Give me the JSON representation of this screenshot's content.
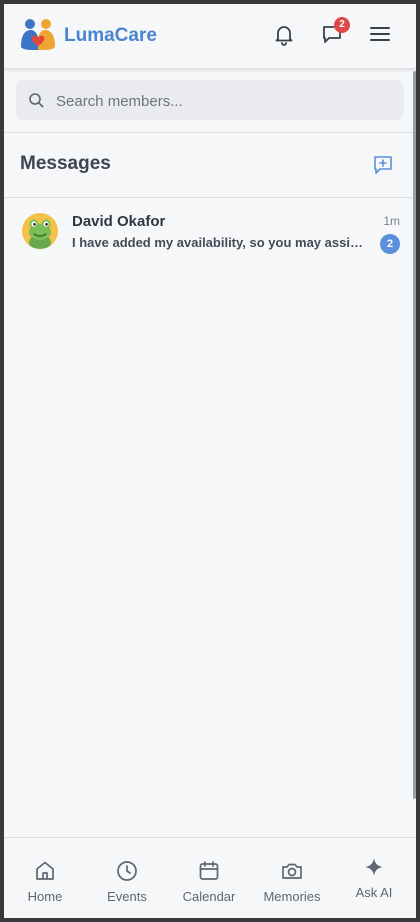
{
  "app": {
    "brand": "LumaCare"
  },
  "header": {
    "chat_badge": "2"
  },
  "search": {
    "placeholder": "Search members..."
  },
  "messages": {
    "title": "Messages",
    "items": [
      {
        "name": "David Okafor",
        "preview": "I have added my availability, so you may assign me wherever needed.",
        "time": "1m",
        "unread": "2"
      }
    ]
  },
  "nav": {
    "items": [
      {
        "label": "Home",
        "icon": "home-icon"
      },
      {
        "label": "Events",
        "icon": "clock-icon"
      },
      {
        "label": "Calendar",
        "icon": "calendar-icon"
      },
      {
        "label": "Memories",
        "icon": "camera-icon"
      },
      {
        "label": "Ask AI",
        "icon": "sparkle-icon"
      }
    ]
  },
  "colors": {
    "brand": "#4b84d0",
    "badge_red": "#e04848",
    "badge_blue": "#5b8fdc",
    "background": "#f6f7f9"
  }
}
